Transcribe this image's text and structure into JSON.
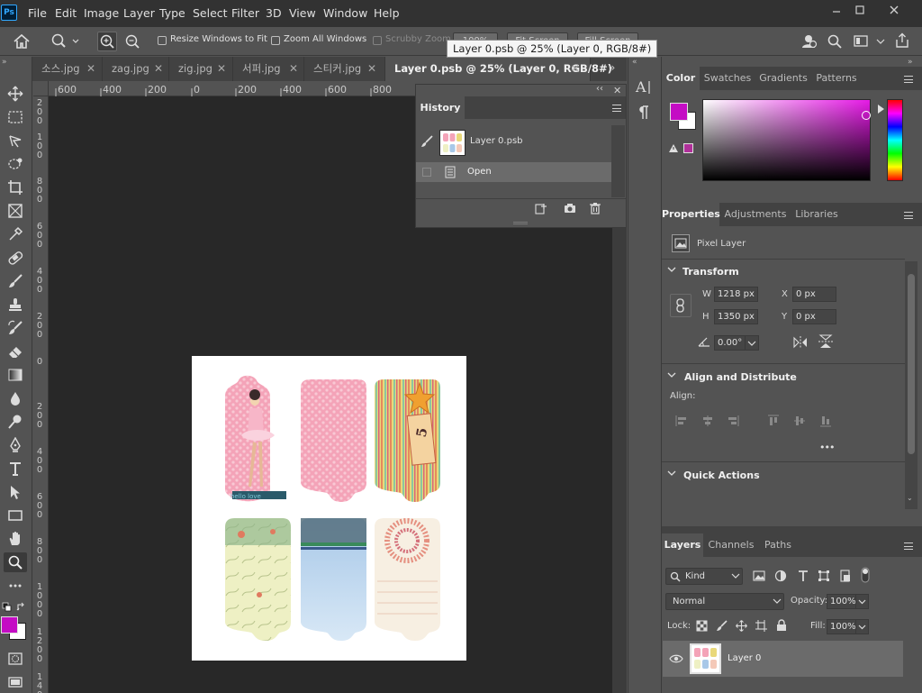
{
  "app": {
    "logo": "Ps"
  },
  "menu": [
    "File",
    "Edit",
    "Image",
    "Layer",
    "Type",
    "Select",
    "Filter",
    "3D",
    "View",
    "Window",
    "Help"
  ],
  "options": {
    "resize_windows": "Resize Windows to Fit",
    "zoom_all": "Zoom All Windows",
    "scrubby_zoom": "Scrubby Zoom",
    "zoom_level": "100%",
    "fit_screen": "Fit Screen",
    "fill_screen": "Fill Screen"
  },
  "tooltip": "Layer 0.psb @ 25% (Layer 0, RGB/8#)",
  "tabs": [
    {
      "label": "소스.jpg"
    },
    {
      "label": "zag.jpg"
    },
    {
      "label": "zig.jpg"
    },
    {
      "label": "서퍼.jpg"
    },
    {
      "label": "스티커.jpg"
    },
    {
      "label": "Layer 0.psb @ 25% (Layer 0, RGB/8#)"
    }
  ],
  "ruler": {
    "h": [
      "600",
      "400",
      "200",
      "0",
      "200",
      "400",
      "600",
      "800"
    ],
    "v": [
      "2 0 0",
      "1 0 0",
      "8 0 0",
      "6 0 0",
      "4 0 0",
      "2 0 0",
      "0",
      "2 0 0",
      "4 0 0",
      "6 0 0",
      "8 0 0",
      "1 0 0 0",
      "1 2 0 0",
      "1 4 0 0"
    ]
  },
  "history": {
    "title": "History",
    "snapshot": "Layer 0.psb",
    "states": [
      "Open"
    ]
  },
  "color_panel": {
    "tabs": [
      "Color",
      "Swatches",
      "Gradients",
      "Patterns"
    ],
    "foreground": "#c40cc4",
    "background": "#ffffff"
  },
  "properties": {
    "tabs": [
      "Properties",
      "Adjustments",
      "Libraries"
    ],
    "layer_type": "Pixel Layer",
    "transform_title": "Transform",
    "w_label": "W",
    "w": "1218 px",
    "h_label": "H",
    "h": "1350 px",
    "x_label": "X",
    "x": "0 px",
    "y_label": "Y",
    "y": "0 px",
    "angle": "0.00°",
    "align_title": "Align and Distribute",
    "align_label": "Align:",
    "quick_actions": "Quick Actions",
    "more": "•••"
  },
  "layers": {
    "tabs": [
      "Layers",
      "Channels",
      "Paths"
    ],
    "filter_kind": "Kind",
    "blend_mode": "Normal",
    "opacity_label": "Opacity:",
    "opacity": "100%",
    "lock_label": "Lock:",
    "fill_label": "Fill:",
    "fill": "100%",
    "layer_name": "Layer 0"
  },
  "tag_text": {
    "hello": "hello love",
    "number": "5"
  }
}
